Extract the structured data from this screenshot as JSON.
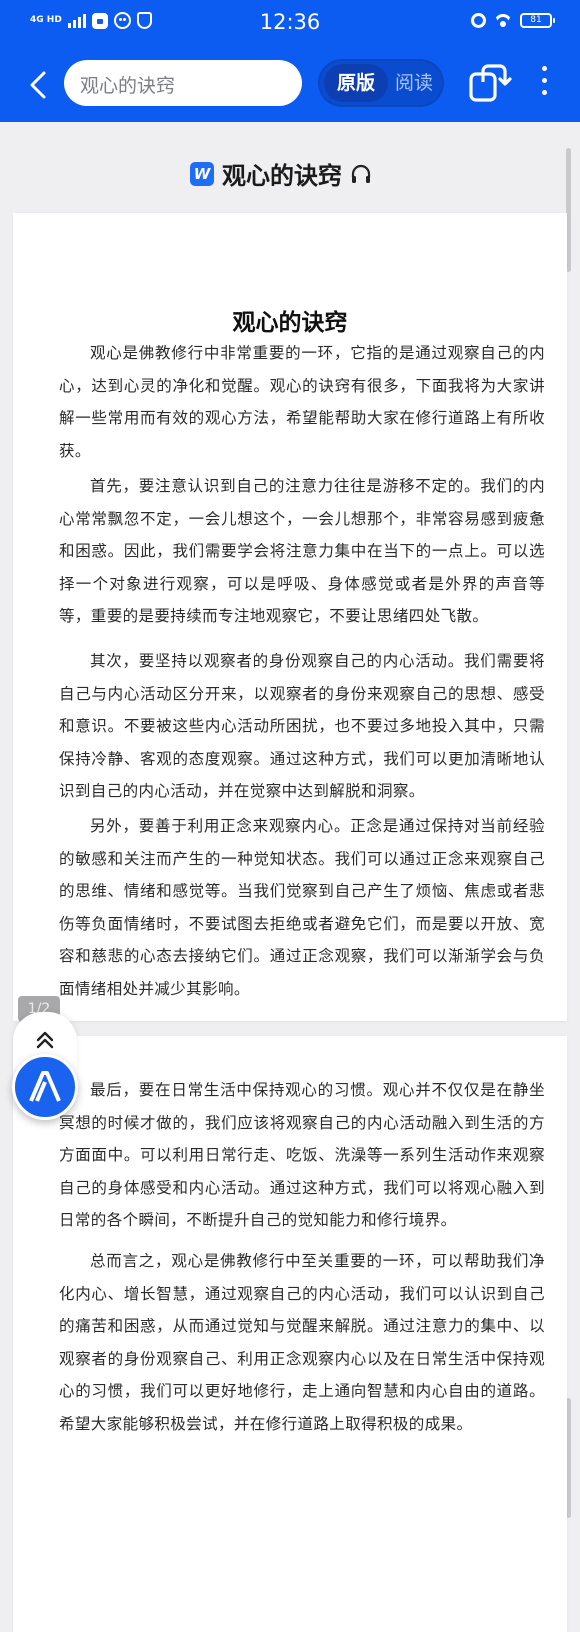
{
  "status_bar": {
    "network": "4G HD",
    "time": "12:36",
    "battery": "81"
  },
  "app_bar": {
    "search_text": "观心的诀窍",
    "mode_original": "原版",
    "mode_reading": "阅读"
  },
  "document": {
    "header_title": "观心的诀窍",
    "article_title": "观心的诀窍",
    "paragraphs_page1": [
      "观心是佛教修行中非常重要的一环，它指的是通过观察自己的内心，达到心灵的净化和觉醒。观心的诀窍有很多，下面我将为大家讲解一些常用而有效的观心方法，希望能帮助大家在修行道路上有所收获。",
      "首先，要注意认识到自己的注意力往往是游移不定的。我们的内心常常飘忽不定，一会儿想这个，一会儿想那个，非常容易感到疲惫和困惑。因此，我们需要学会将注意力集中在当下的一点上。可以选择一个对象进行观察，可以是呼吸、身体感觉或者是外界的声音等等，重要的是要持续而专注地观察它，不要让思绪四处飞散。",
      "其次，要坚持以观察者的身份观察自己的内心活动。我们需要将自己与内心活动区分开来，以观察者的身份来观察自己的思想、感受和意识。不要被这些内心活动所困扰，也不要过多地投入其中，只需保持冷静、客观的态度观察。通过这种方式，我们可以更加清晰地认识到自己的内心活动，并在觉察中达到解脱和洞察。",
      "另外，要善于利用正念来观察内心。正念是通过保持对当前经验的敏感和关注而产生的一种觉知状态。我们可以通过正念来观察自己的思维、情绪和感觉等。当我们觉察到自己产生了烦恼、焦虑或者悲伤等负面情绪时，不要试图去拒绝或者避免它们，而是要以开放、宽容和慈悲的心态去接纳它们。通过正念观察，我们可以渐渐学会与负面情绪相处并减少其影响。"
    ],
    "paragraphs_page2": [
      "最后，要在日常生活中保持观心的习惯。观心并不仅仅是在静坐冥想的时候才做的，我们应该将观察自己的内心活动融入到生活的方方面面中。可以利用日常行走、吃饭、洗澡等一系列生活动作来观察自己的身体感受和内心活动。通过这种方式，我们可以将观心融入到日常的各个瞬间，不断提升自己的觉知能力和修行境界。",
      "总而言之，观心是佛教修行中至关重要的一环，可以帮助我们净化内心、增长智慧，通过观察自己的内心活动，我们可以认识到自己的痛苦和困惑，从而通过觉知与觉醒来解脱。通过注意力的集中、以观察者的身份观察自己、利用正念观察内心以及在日常生活中保持观心的习惯，我们可以更好地修行，走上通向智慧和内心自由的道路。希望大家能够积极尝试，并在修行道路上取得积极的成果。"
    ],
    "page_indicator": "1/2"
  },
  "colors": {
    "brand_blue": "#0d5cf2",
    "page_bg": "#efeff1"
  },
  "icons": [
    "back-arrow-icon",
    "share-rotate-icon",
    "more-vertical-icon",
    "w-doc-icon",
    "headphone-icon",
    "double-chevron-up-icon",
    "ai-assistant-icon"
  ]
}
